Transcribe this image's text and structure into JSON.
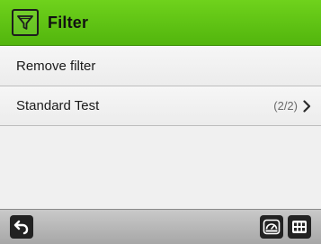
{
  "header": {
    "title": "Filter",
    "icon": "filter-icon",
    "color": "#5cc212"
  },
  "list": {
    "items": [
      {
        "label": "Remove filter",
        "count": ""
      },
      {
        "label": "Standard Test",
        "count": "(2/2)"
      }
    ]
  },
  "footer": {
    "left_icon": "back-arrow-icon",
    "right_icons": [
      "speedometer-icon",
      "grid-menu-icon"
    ]
  }
}
